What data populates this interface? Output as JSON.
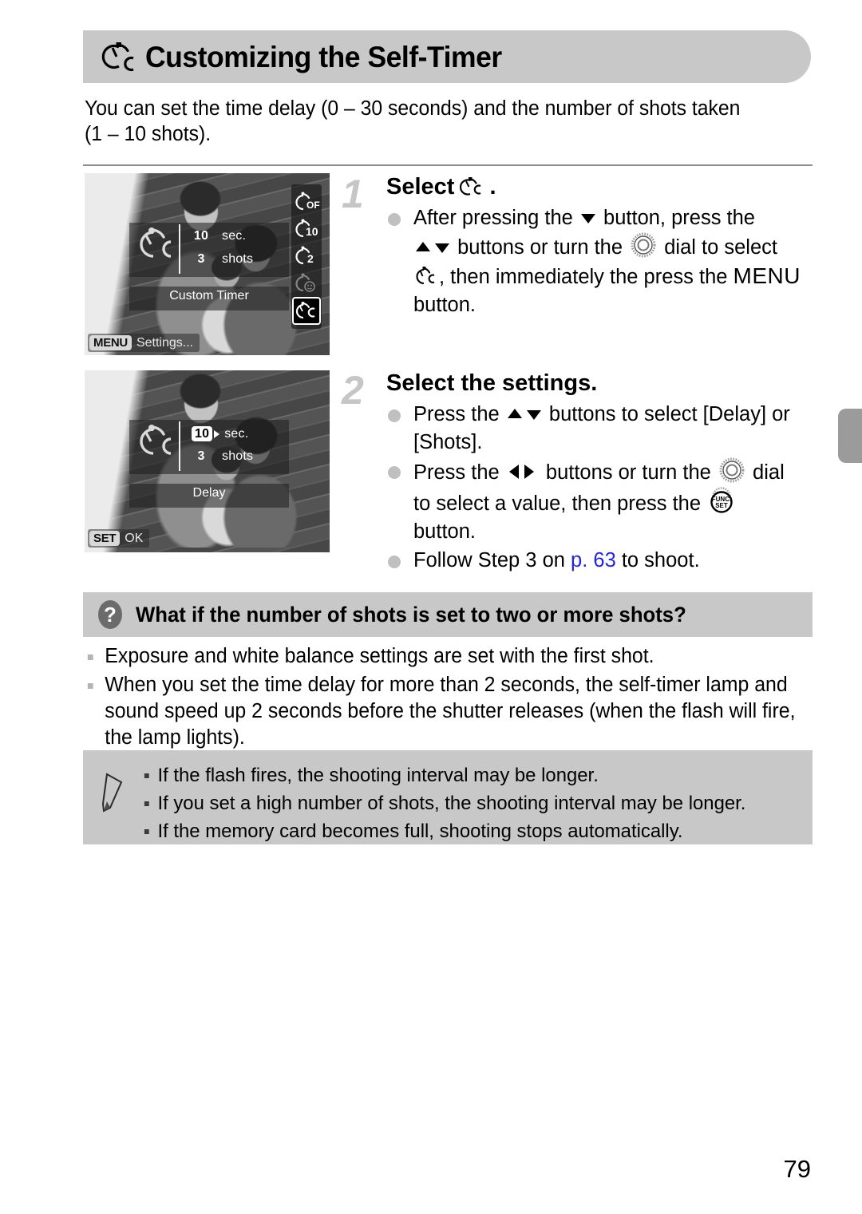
{
  "page": {
    "number": "79",
    "tab_icon": "page-tab-marker"
  },
  "title": {
    "icon": "custom-self-timer-icon",
    "text": "Customizing the Self-Timer"
  },
  "intro": {
    "line1": "You can set the time delay (0 – 30 seconds) and the number of shots taken",
    "line2": "(1 – 10 shots)."
  },
  "steps": [
    {
      "number": "1",
      "heading_prefix": "Select",
      "heading_icon": "custom-self-timer-icon",
      "heading_suffix": ".",
      "bullets": [
        {
          "lines": [
            {
              "parts": [
                {
                  "type": "text",
                  "value": "After pressing the "
                },
                {
                  "type": "icon",
                  "value": "down-button-icon"
                },
                {
                  "type": "text",
                  "value": " button, press the"
                }
              ]
            },
            {
              "parts": [
                {
                  "type": "icon",
                  "value": "up-down-buttons-icon"
                },
                {
                  "type": "text",
                  "value": " buttons or turn the "
                },
                {
                  "type": "icon",
                  "value": "control-dial-icon"
                },
                {
                  "type": "text",
                  "value": " dial to select"
                }
              ]
            },
            {
              "parts": [
                {
                  "type": "icon",
                  "value": "custom-self-timer-icon"
                },
                {
                  "type": "text",
                  "value": ", then immediately the press the "
                },
                {
                  "type": "menu",
                  "value": "MENU"
                }
              ]
            },
            {
              "parts": [
                {
                  "type": "text",
                  "value": "button."
                }
              ]
            }
          ]
        }
      ]
    },
    {
      "number": "2",
      "heading_prefix": "Select the settings.",
      "heading_icon": "",
      "heading_suffix": "",
      "bullets": [
        {
          "lines": [
            {
              "parts": [
                {
                  "type": "text",
                  "value": "Press the "
                },
                {
                  "type": "icon",
                  "value": "up-down-buttons-icon"
                },
                {
                  "type": "text",
                  "value": " buttons to select [Delay] or"
                }
              ]
            },
            {
              "parts": [
                {
                  "type": "text",
                  "value": "[Shots]."
                }
              ]
            }
          ]
        },
        {
          "lines": [
            {
              "parts": [
                {
                  "type": "text",
                  "value": "Press the "
                },
                {
                  "type": "icon",
                  "value": "left-right-buttons-icon"
                },
                {
                  "type": "text",
                  "value": " buttons or turn the "
                },
                {
                  "type": "icon",
                  "value": "control-dial-icon"
                },
                {
                  "type": "text",
                  "value": " dial"
                }
              ]
            },
            {
              "parts": [
                {
                  "type": "text",
                  "value": "to select a value, then press the "
                },
                {
                  "type": "icon",
                  "value": "func-set-button-icon"
                }
              ]
            },
            {
              "parts": [
                {
                  "type": "text",
                  "value": "button."
                }
              ]
            }
          ]
        },
        {
          "lines": [
            {
              "parts": [
                {
                  "type": "text",
                  "value": "Follow Step 3 on "
                },
                {
                  "type": "link",
                  "value": "p. 63"
                },
                {
                  "type": "text",
                  "value": " to shoot."
                }
              ]
            }
          ]
        }
      ]
    }
  ],
  "screens": [
    {
      "name": "custom-timer-menu-screen",
      "delay_value": "10",
      "delay_unit": "sec.",
      "shots_value": "3",
      "shots_unit": "shots",
      "mode_label": "Custom Timer",
      "delay_highlighted": false,
      "bottom_key": "MENU",
      "bottom_text": "Settings...",
      "options": [
        {
          "name": "self-timer-off-option",
          "label": "OFF",
          "state": "normal"
        },
        {
          "name": "self-timer-10s-option",
          "label": "10",
          "state": "normal"
        },
        {
          "name": "self-timer-2s-option",
          "label": "2",
          "state": "normal"
        },
        {
          "name": "self-timer-face-option",
          "label": "face",
          "state": "dim"
        },
        {
          "name": "self-timer-custom-option",
          "label": "C",
          "state": "selected"
        }
      ]
    },
    {
      "name": "custom-timer-delay-screen",
      "delay_value": "10",
      "delay_unit": "sec.",
      "shots_value": "3",
      "shots_unit": "shots",
      "mode_label": "Delay",
      "delay_highlighted": true,
      "bottom_key": "SET",
      "bottom_text": "OK",
      "options": []
    }
  ],
  "qa": {
    "icon": "question-mark-icon",
    "title": "What if the number of shots is set to two or more shots?",
    "items": [
      "Exposure and white balance settings are set with the first shot.",
      "When you set the time delay for more than 2 seconds, the self-timer lamp and sound speed up 2 seconds before the shutter releases (when the flash will fire, the lamp lights)."
    ]
  },
  "note": {
    "icon": "pencil-icon",
    "items": [
      "If the flash fires, the shooting interval may be longer.",
      "If you set a high number of shots, the shooting interval may be longer.",
      "If the memory card becomes full, shooting stops automatically."
    ]
  }
}
